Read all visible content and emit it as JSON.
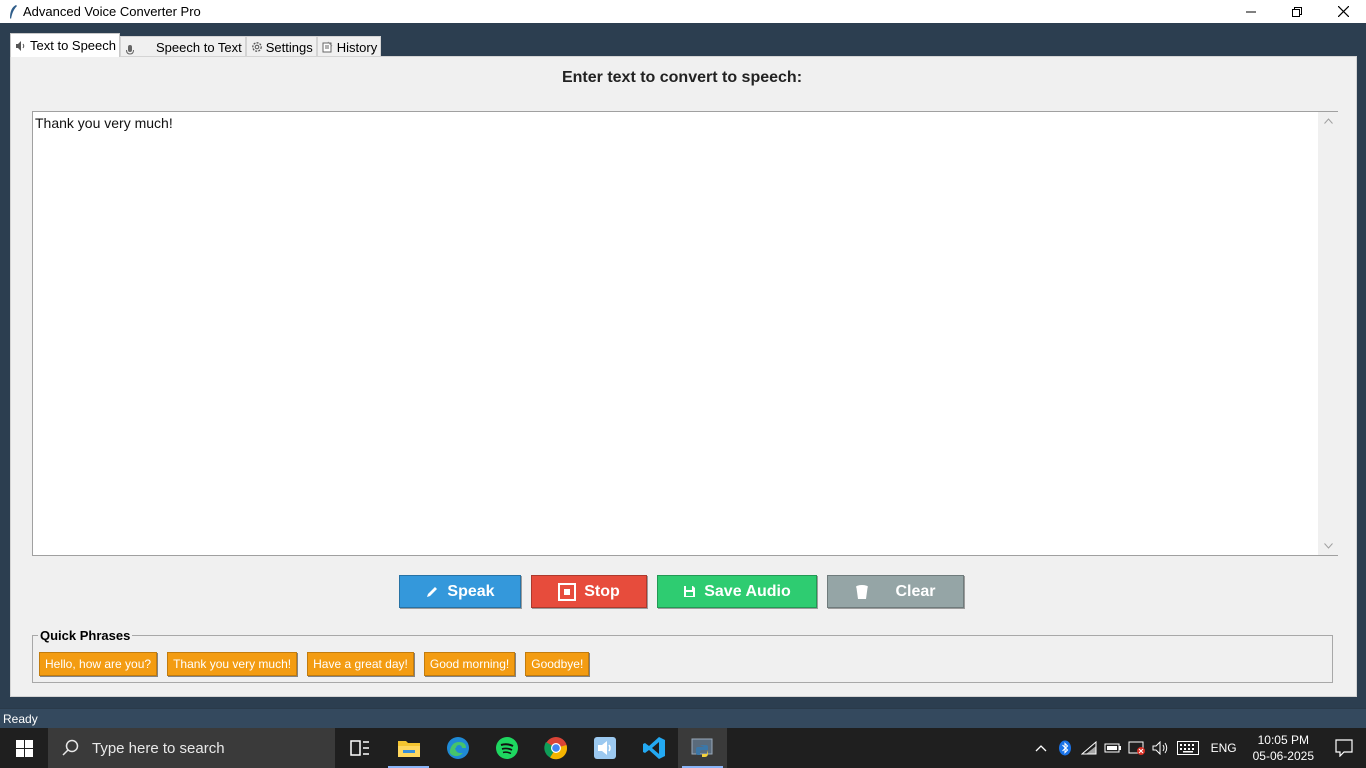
{
  "window": {
    "title": "Advanced Voice Converter Pro"
  },
  "tabs": [
    {
      "label": "Text to Speech",
      "icon": "speaker-icon"
    },
    {
      "label": "Speech to Text",
      "icon": "microphone-icon"
    },
    {
      "label": "Settings",
      "icon": "gear-icon"
    },
    {
      "label": "History",
      "icon": "notepad-icon"
    }
  ],
  "tts": {
    "heading": "Enter text to convert to speech:",
    "text_value": "Thank you very much!",
    "buttons": {
      "speak": "Speak",
      "stop": "Stop",
      "save": "Save Audio",
      "clear": "Clear"
    },
    "quick_phrases": {
      "legend": "Quick Phrases",
      "items": [
        "Hello, how are you?",
        "Thank you very much!",
        "Have a great day!",
        "Good morning!",
        "Goodbye!"
      ]
    }
  },
  "status": {
    "text": "Ready"
  },
  "taskbar": {
    "search_placeholder": "Type here to search",
    "language": "ENG",
    "time": "10:05 PM",
    "date": "05-06-2025"
  },
  "colors": {
    "speak": "#3498db",
    "stop": "#e74c3c",
    "save": "#2ecc71",
    "clear": "#95a5a6",
    "quick_phrase": "#f39c12",
    "app_background": "#2c3e50",
    "statusbar": "#34495e"
  }
}
